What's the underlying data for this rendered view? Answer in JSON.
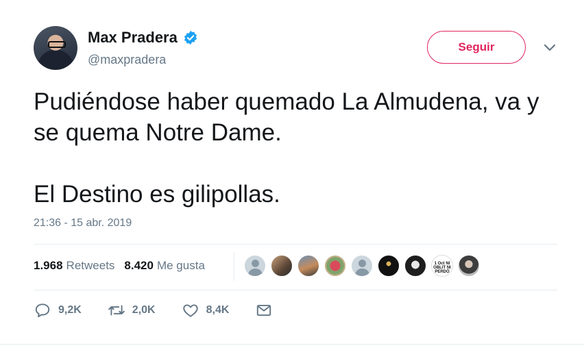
{
  "user": {
    "display_name": "Max Pradera",
    "handle": "@maxpradera",
    "verified": true
  },
  "follow_button": {
    "label": "Seguir"
  },
  "tweet": {
    "paragraphs": [
      "Pudiéndose haber quemado La Almudena, va y se quema Notre Dame.",
      "El Destino es gilipollas."
    ],
    "timestamp": "21:36 - 15 abr. 2019"
  },
  "stats": {
    "retweets": {
      "value": "1.968",
      "label": "Retweets"
    },
    "likes": {
      "value": "8.420",
      "label": "Me gusta"
    }
  },
  "liker_avatars": [
    {
      "icon": "default-avatar-icon"
    },
    {
      "icon": "avatar-photo"
    },
    {
      "icon": "avatar-photo"
    },
    {
      "icon": "avatar-photo"
    },
    {
      "icon": "default-avatar-icon"
    },
    {
      "icon": "avatar-photo"
    },
    {
      "icon": "avatar-photo"
    },
    {
      "icon": "ribbon-avatar",
      "text": "1 Oct NI OBLIT NI PERDÓ"
    },
    {
      "icon": "avatar-photo"
    }
  ],
  "actions": {
    "reply": {
      "icon": "reply-icon",
      "count": "9,2K"
    },
    "retweet": {
      "icon": "retweet-icon",
      "count": "2,0K"
    },
    "like": {
      "icon": "heart-icon",
      "count": "8,4K"
    },
    "dm": {
      "icon": "envelope-icon"
    }
  },
  "colors": {
    "follow_accent": "#e0245e",
    "verified_blue": "#1da1f2",
    "secondary_text": "#657786",
    "divider": "#e6ecf0"
  }
}
